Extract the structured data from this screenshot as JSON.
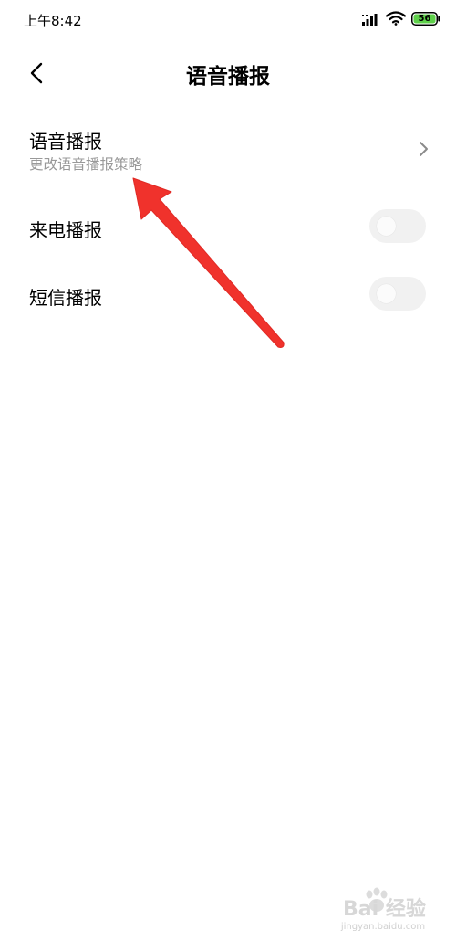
{
  "status_bar": {
    "time": "上午8:42",
    "battery_level": "56",
    "battery_color": "#5ed04a"
  },
  "header": {
    "title": "语音播报",
    "back_icon": "chevron-left-icon"
  },
  "settings": {
    "voice_broadcast": {
      "title": "语音播报",
      "subtitle": "更改语音播报策略",
      "icon": "chevron-right-icon"
    },
    "incoming_call_broadcast": {
      "title": "来电播报",
      "enabled": false
    },
    "sms_broadcast": {
      "title": "短信播报",
      "enabled": false
    }
  },
  "annotation": {
    "type": "arrow",
    "color": "#f0322c"
  },
  "watermark": {
    "brand": "Bai 经验",
    "url": "jingyan.baidu.com"
  }
}
